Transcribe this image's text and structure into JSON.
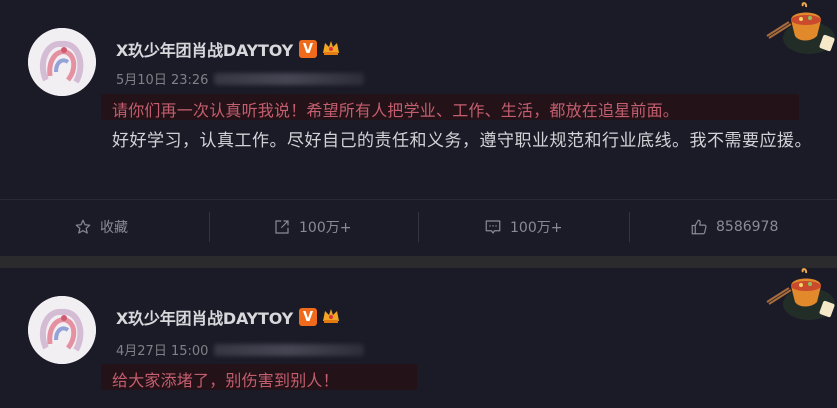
{
  "posts": [
    {
      "author": "X玖少年团肖战DAYTOY",
      "verified_badge": "V",
      "time": "5月10日 23:26",
      "highlight_text": "请你们再一次认真听我说！希望所有人把学业、工作、生活，都放在追星前面。",
      "body_text": "好好学习，认真工作。尽好自己的责任和义务，遵守职业规范和行业底线。我不需要应援。",
      "actions": {
        "favorite": "收藏",
        "repost": "100万+",
        "comment": "100万+",
        "like": "8586978"
      }
    },
    {
      "author": "X玖少年团肖战DAYTOY",
      "verified_badge": "V",
      "time": "4月27日 15:00",
      "highlight_text": "给大家添堵了，别伤害到别人！"
    }
  ],
  "colors": {
    "card_bg": "#1b1a27",
    "highlight_bg": "#241219",
    "highlight_text": "#c25e6e",
    "badge": "#f06a1b"
  },
  "icons": [
    "star-icon",
    "repost-icon",
    "comment-icon",
    "like-icon",
    "crown-icon",
    "hotpot-decoration-icon"
  ]
}
